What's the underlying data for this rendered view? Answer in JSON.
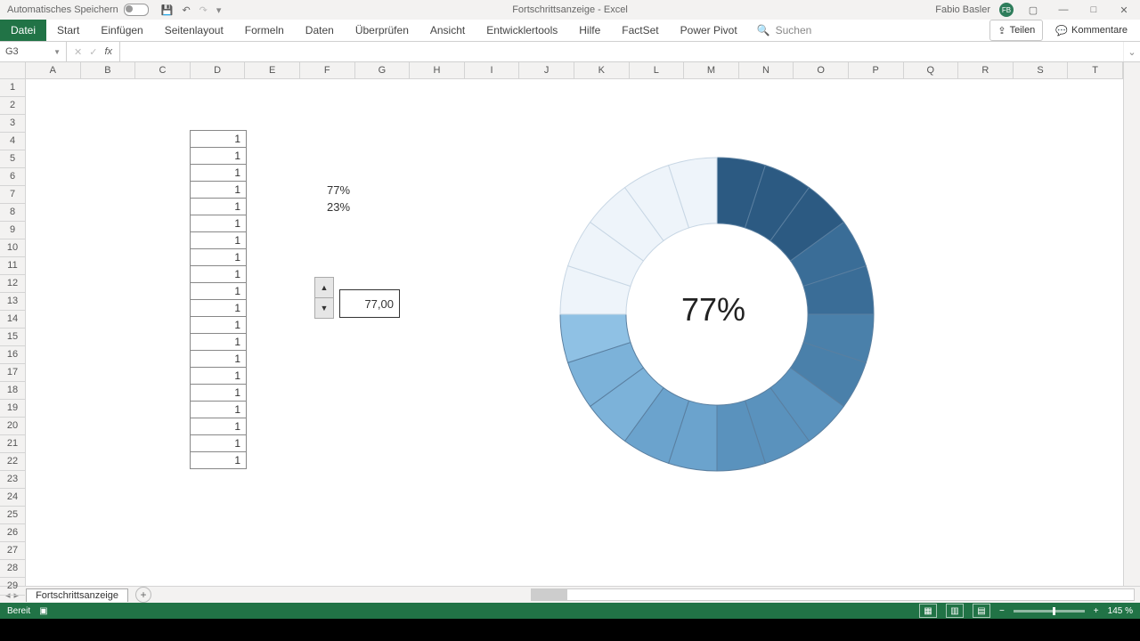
{
  "titlebar": {
    "autosave_label": "Automatisches Speichern",
    "document": "Fortschrittsanzeige",
    "separator": " - ",
    "app": "Excel",
    "user": "Fabio Basler",
    "avatar_initials": "FB"
  },
  "ribbon": {
    "file": "Datei",
    "tabs": [
      "Start",
      "Einfügen",
      "Seitenlayout",
      "Formeln",
      "Daten",
      "Überprüfen",
      "Ansicht",
      "Entwicklertools",
      "Hilfe",
      "FactSet",
      "Power Pivot"
    ],
    "search_placeholder": "Suchen",
    "share": "Teilen",
    "comments": "Kommentare"
  },
  "formula": {
    "namebox": "G3",
    "fx": "fx",
    "value": ""
  },
  "grid": {
    "columns": [
      "A",
      "B",
      "C",
      "D",
      "E",
      "F",
      "G",
      "H",
      "I",
      "J",
      "K",
      "L",
      "M",
      "N",
      "O",
      "P",
      "Q",
      "R",
      "S",
      "T"
    ],
    "rows": 29,
    "data_column_values": [
      "1",
      "1",
      "1",
      "1",
      "1",
      "1",
      "1",
      "1",
      "1",
      "1",
      "1",
      "1",
      "1",
      "1",
      "1",
      "1",
      "1",
      "1",
      "1",
      "1"
    ],
    "pct1": "77%",
    "pct2": "23%",
    "spinner_value": "77,00"
  },
  "sheet": {
    "name": "Fortschrittsanzeige"
  },
  "status": {
    "ready": "Bereit",
    "zoom": "145 %"
  },
  "chart_data": {
    "type": "pie",
    "title": "",
    "segments": 20,
    "percent_complete": 77,
    "center_label": "77%",
    "inner_radius_ratio": 0.58,
    "complete_gradient": [
      "#2c5a82",
      "#3a6d97",
      "#4a80aa",
      "#5a92bd",
      "#6ba3cd",
      "#7cb2d9",
      "#8fc1e4"
    ],
    "incomplete_color": "#eef4fa",
    "segment_border": "#5a7fa0"
  }
}
